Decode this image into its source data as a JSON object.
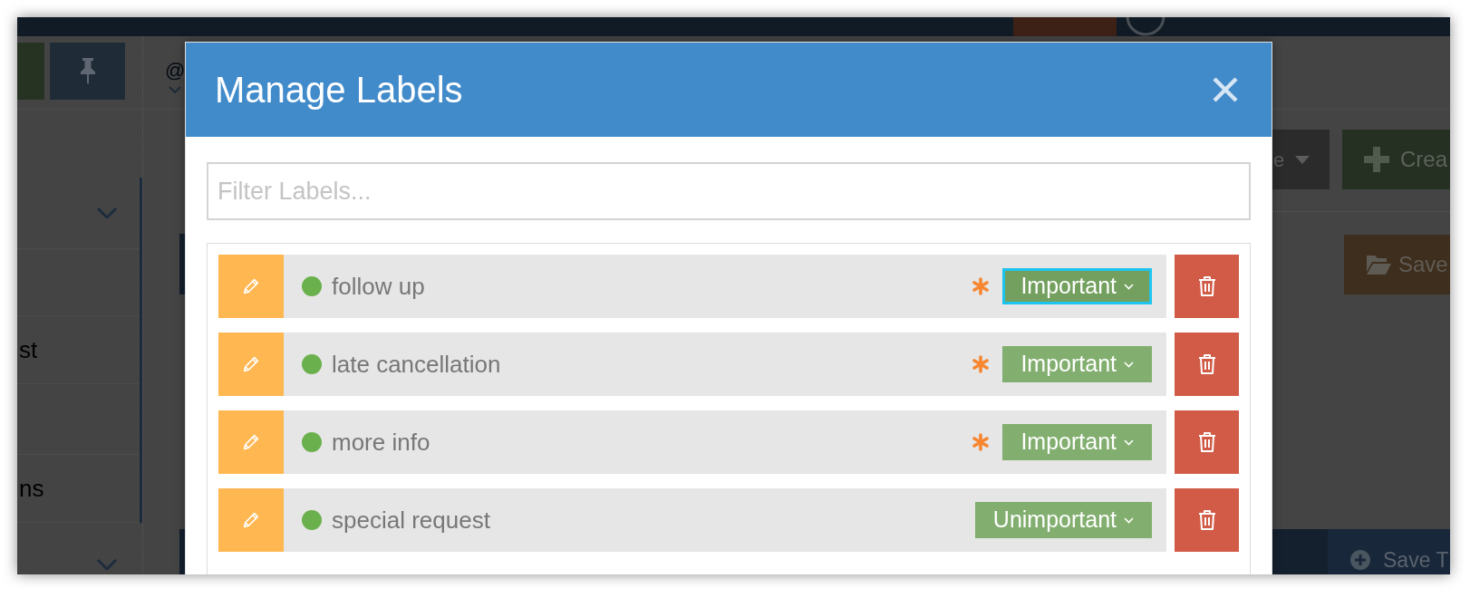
{
  "sidebar": {
    "items": [
      {
        "kind": "group",
        "expanded": false
      },
      {
        "kind": "item"
      },
      {
        "kind": "item",
        "label": "st"
      },
      {
        "kind": "item"
      },
      {
        "kind": "item",
        "label": "ns"
      }
    ],
    "section_2": {
      "expanded": false
    }
  },
  "mention_menu": {
    "label": "@"
  },
  "toolbar": [
    {
      "kind": "dropdown",
      "label": "e"
    },
    {
      "kind": "create",
      "label": "Crea"
    }
  ],
  "save_button": {
    "label": "Save"
  },
  "footer": {
    "save_button": {
      "label": "Save T"
    }
  },
  "modal": {
    "title": "Manage Labels",
    "filter": {
      "placeholder": "Filter Labels..."
    },
    "labels": [
      {
        "name": "follow up",
        "color": "#6ab04c",
        "flagged": true,
        "priority": "Important",
        "focused": true
      },
      {
        "name": "late cancellation",
        "color": "#6ab04c",
        "flagged": true,
        "priority": "Important",
        "focused": false
      },
      {
        "name": "more info",
        "color": "#6ab04c",
        "flagged": true,
        "priority": "Important",
        "focused": false
      },
      {
        "name": "special request",
        "color": "#6ab04c",
        "flagged": false,
        "priority": "Unimportant",
        "focused": false
      }
    ]
  }
}
